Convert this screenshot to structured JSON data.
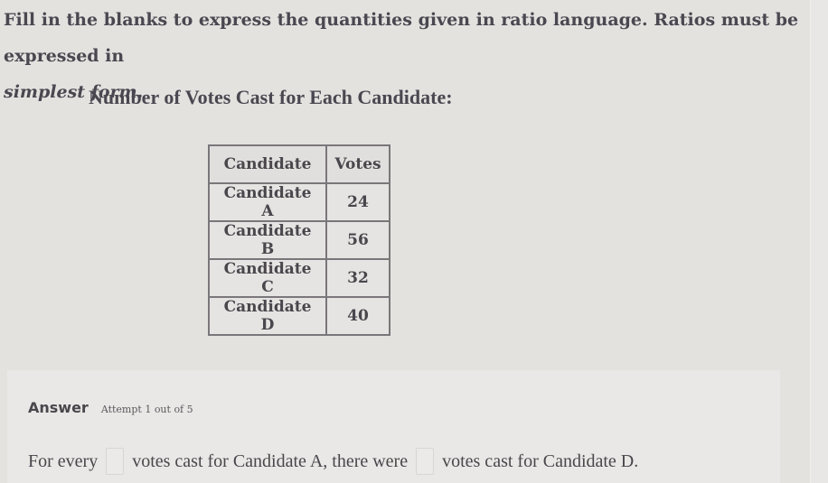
{
  "instructions": {
    "line": "Fill in the blanks to express the quantities given in ratio language. Ratios must be expressed in",
    "emphasis": "simplest form."
  },
  "table": {
    "title": "Number of Votes Cast for Each Candidate:",
    "headers": [
      "Candidate",
      "Votes"
    ],
    "rows": [
      {
        "candidate": "Candidate A",
        "votes": "24"
      },
      {
        "candidate": "Candidate B",
        "votes": "56"
      },
      {
        "candidate": "Candidate C",
        "votes": "32"
      },
      {
        "candidate": "Candidate D",
        "votes": "40"
      }
    ]
  },
  "answer": {
    "label": "Answer",
    "attempt": "Attempt 1 out of 5",
    "sentence_part1": "For every",
    "sentence_part2": "votes cast for Candidate A, there were",
    "sentence_part3": "votes cast for Candidate D.",
    "blank1_value": "",
    "blank2_value": ""
  }
}
